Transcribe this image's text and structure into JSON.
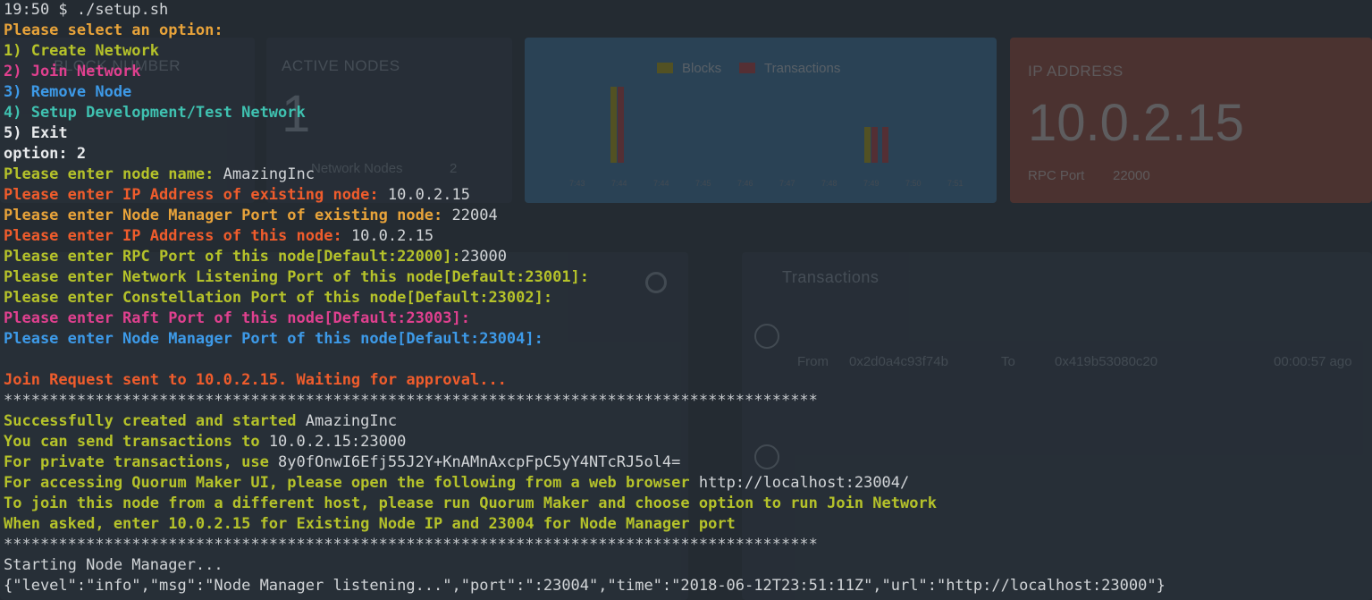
{
  "terminal": {
    "lines": [
      {
        "text": "19:50 $ ./setup.sh",
        "color": "#d2d5d8",
        "bold": false
      },
      {
        "text": "Please select an option:",
        "color": "#e8a33a",
        "bold": true
      },
      {
        "text": "1) Create Network",
        "color": "#b5c22a",
        "bold": true
      },
      {
        "text": "2) Join Network",
        "color": "#e0408f",
        "bold": true
      },
      {
        "text": "3) Remove Node",
        "color": "#3d9ae8",
        "bold": true
      },
      {
        "text": "4) Setup Development/Test Network",
        "color": "#3fc1b0",
        "bold": true
      },
      {
        "text": "5) Exit",
        "color": "#e8eaec",
        "bold": true
      },
      {
        "text": "option: 2",
        "color": "#e8eaec",
        "bold": true
      },
      {
        "prompt": "Please enter node name:",
        "value": " AmazingInc",
        "color": "#b5c22a"
      },
      {
        "prompt": "Please enter IP Address of existing node:",
        "value": " 10.0.2.15",
        "color": "#ef5c2c"
      },
      {
        "prompt": "Please enter Node Manager Port of existing node:",
        "value": " 22004",
        "color": "#e8a33a"
      },
      {
        "prompt": "Please enter IP Address of this node:",
        "value": " 10.0.2.15",
        "color": "#ef5c2c"
      },
      {
        "prompt": "Please enter RPC Port of this node[Default:22000]:",
        "value": "23000",
        "color": "#b5c22a"
      },
      {
        "prompt": "Please enter Network Listening Port of this node[Default:23001]:",
        "value": "",
        "color": "#b5c22a"
      },
      {
        "prompt": "Please enter Constellation Port of this node[Default:23002]:",
        "value": "",
        "color": "#b5c22a"
      },
      {
        "prompt": "Please enter Raft Port of this node[Default:23003]:",
        "value": "",
        "color": "#e0408f"
      },
      {
        "prompt": "Please enter Node Manager Port of this node[Default:23004]:",
        "value": "",
        "color": "#3d9ae8"
      },
      {
        "text": "",
        "color": "#d2d5d8",
        "bold": false
      },
      {
        "text": "Join Request sent to 10.0.2.15. Waiting for approval...",
        "color": "#ef5c2c",
        "bold": true
      },
      {
        "text": "*****************************************************************************************",
        "color": "#c7cacd",
        "bold": false
      },
      {
        "prompt": "Successfully created and started",
        "value": " AmazingInc",
        "color": "#b5c22a"
      },
      {
        "prompt": "You can send transactions to",
        "value": " 10.0.2.15:23000",
        "color": "#b5c22a"
      },
      {
        "prompt": "For private transactions, use",
        "value": " 8y0fOnwI6Efj55J2Y+KnAMnAxcpFpC5yY4NTcRJ5ol4=",
        "color": "#b5c22a"
      },
      {
        "prompt": "For accessing Quorum Maker UI, please open the following from a web browser",
        "value": " http://localhost:23004/",
        "color": "#b5c22a"
      },
      {
        "text": "To join this node from a different host, please run Quorum Maker and choose option to run Join Network",
        "color": "#b5c22a",
        "bold": true
      },
      {
        "text": "When asked, enter 10.0.2.15 for Existing Node IP and 23004 for Node Manager port",
        "color": "#b5c22a",
        "bold": true
      },
      {
        "text": "*****************************************************************************************",
        "color": "#c7cacd",
        "bold": false
      },
      {
        "text": "Starting Node Manager...",
        "color": "#d2d5d8",
        "bold": false
      },
      {
        "text": "{\"level\":\"info\",\"msg\":\"Node Manager listening...\",\"port\":\":23004\",\"time\":\"2018-06-12T23:51:11Z\",\"url\":\"http://localhost:23000\"}",
        "color": "#d2d5d8",
        "bold": false
      }
    ]
  },
  "dashboard": {
    "block_card_title": "BLOCK NUMBER",
    "active_nodes_title": "ACTIVE NODES",
    "active_nodes_value": "1",
    "network_nodes_label": "Network Nodes",
    "network_nodes_value": "2",
    "chart_legend_blocks": "Blocks",
    "chart_legend_transactions": "Transactions",
    "chart_ticks": [
      "7:43",
      "7:44",
      "7:44",
      "7:45",
      "7:46",
      "7:47",
      "7:48",
      "7:49",
      "7:50",
      "7:51"
    ],
    "ip_title": "IP ADDRESS",
    "ip_value": "10.0.2.15",
    "rpc_label": "RPC Port",
    "rpc_value": "22000",
    "transactions_title": "Transactions",
    "tx_from_label": "From",
    "tx_to_label": "To",
    "tx_from": "0x2d0a4c93f74b",
    "tx_to": "0x419b53080c20",
    "tx_ago": "00:00:57 ago",
    "colors": {
      "blocks": "#c9b400",
      "transactions": "#d23b3b",
      "chart_card": "#3a7fb0",
      "ip_card": "#b0472c"
    }
  }
}
